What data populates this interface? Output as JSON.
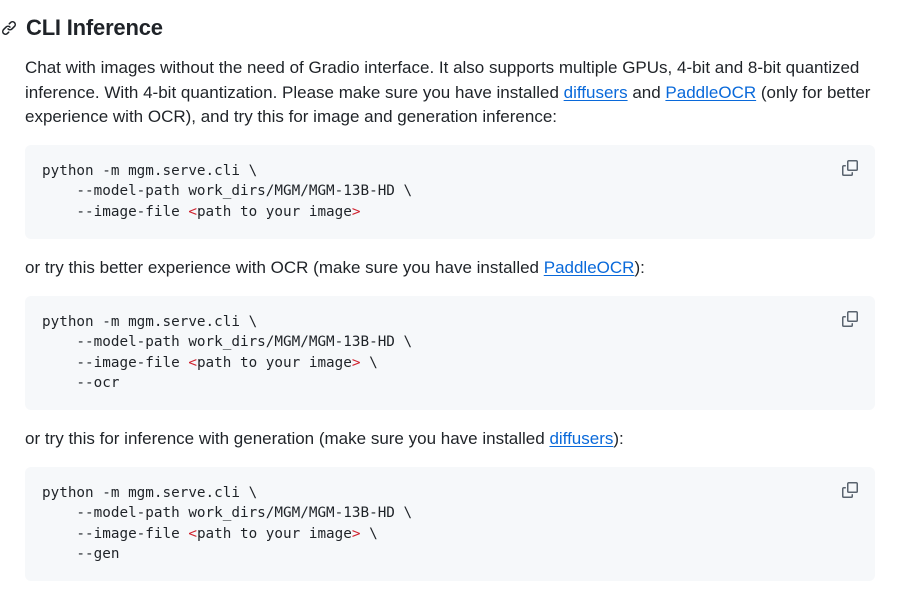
{
  "heading": {
    "title": "CLI Inference",
    "anchor_icon": "link-icon"
  },
  "intro": {
    "part1": "Chat with images without the need of Gradio interface. It also supports multiple GPUs, 4-bit and 8-bit quantized inference. With 4-bit quantization. Please make sure you have installed ",
    "link1": "diffusers",
    "part2": " and ",
    "link2": "PaddleOCR",
    "part3": " (only for better experience with OCR), and try this for image and generation inference:"
  },
  "code1": {
    "line1": "python -m mgm.serve.cli \\",
    "line2": "    --model-path work_dirs/MGM/MGM-13B-HD \\",
    "line3_prefix": "    --image-file ",
    "line3_open": "<",
    "line3_mid": "path to your image",
    "line3_close": ">",
    "copy_icon": "copy-icon"
  },
  "ocr_para": {
    "part1": "or try this better experience with OCR (make sure you have installed ",
    "link": "PaddleOCR",
    "part2": "):"
  },
  "code2": {
    "line1": "python -m mgm.serve.cli \\",
    "line2": "    --model-path work_dirs/MGM/MGM-13B-HD \\",
    "line3_prefix": "    --image-file ",
    "line3_open": "<",
    "line3_mid": "path to your image",
    "line3_close": ">",
    "line3_suffix": " \\",
    "line4": "    --ocr",
    "copy_icon": "copy-icon"
  },
  "gen_para": {
    "part1": "or try this for inference with generation (make sure you have installed ",
    "link": "diffusers",
    "part2": "):"
  },
  "code3": {
    "line1": "python -m mgm.serve.cli \\",
    "line2": "    --model-path work_dirs/MGM/MGM-13B-HD \\",
    "line3_prefix": "    --image-file ",
    "line3_open": "<",
    "line3_mid": "path to your image",
    "line3_close": ">",
    "line3_suffix": " \\",
    "line4": "    --gen",
    "copy_icon": "copy-icon"
  },
  "colors": {
    "text": "#1f2328",
    "link": "#0969da",
    "code_bg": "#f6f8fa",
    "token_red": "#cf222e"
  }
}
